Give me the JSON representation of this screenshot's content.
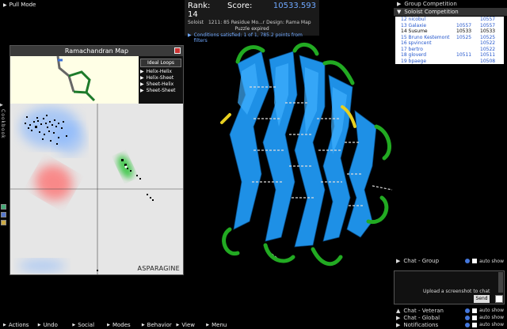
{
  "pull_mode": "Pull Mode",
  "info": {
    "rank_label": "Rank: 14",
    "score_label": "Score:",
    "score_value": "10533.593",
    "mode": "Soloist",
    "puzzle": "1211: 85 Residue Mo...r Design: Rama Map",
    "status": "Puzzle expired",
    "conditions": "Conditions satisfied: 1 of 1, 785.2 points from filters"
  },
  "rama": {
    "title": "Ramachandran Map",
    "ideal_loops": "Ideal Loops",
    "loops": [
      "Helix-Helix",
      "Helix-Sheet",
      "Sheet-Helix",
      "Sheet-Sheet"
    ],
    "residue": "ASPARAGINE"
  },
  "cookbook_label": "Cookbook",
  "group_competition": "Group Competition",
  "soloist_competition": "Soloist Competition",
  "leaderboard": [
    {
      "name": "12 nicobul",
      "s1": "",
      "s2": "10557"
    },
    {
      "name": "13 Galaxie",
      "s1": "10557",
      "s2": "10557"
    },
    {
      "name": "14 Susume",
      "s1": "10533",
      "s2": "10533",
      "me": true
    },
    {
      "name": "15 Bruno Kestemont",
      "s1": "10525",
      "s2": "10525"
    },
    {
      "name": "16 spvincent",
      "s1": "",
      "s2": "10522"
    },
    {
      "name": "17 bertro",
      "s1": "",
      "s2": "10522"
    },
    {
      "name": "18 gloverd",
      "s1": "10511",
      "s2": "10511"
    },
    {
      "name": "19 bpaege",
      "s1": "",
      "s2": "10508"
    }
  ],
  "chat": {
    "group": "Chat - Group",
    "upload": "Upload a screenshot to chat",
    "send": "Send",
    "veteran": "Chat - Veteran",
    "global": "Chat - Global",
    "notifications": "Notifications",
    "auto_show": "auto show"
  },
  "menu": [
    "Actions",
    "Undo",
    "Social",
    "Modes",
    "Behavior",
    "View",
    "Menu"
  ],
  "colors": {
    "accent": "#6fa8ff",
    "sheet": "#1e90e6",
    "loop": "#22aa22",
    "highlight": "#e8d020"
  },
  "icons": [
    "pull-icon",
    "close-icon",
    "triangle-right-icon",
    "triangle-down-icon",
    "info-icon",
    "checkbox-icon"
  ]
}
